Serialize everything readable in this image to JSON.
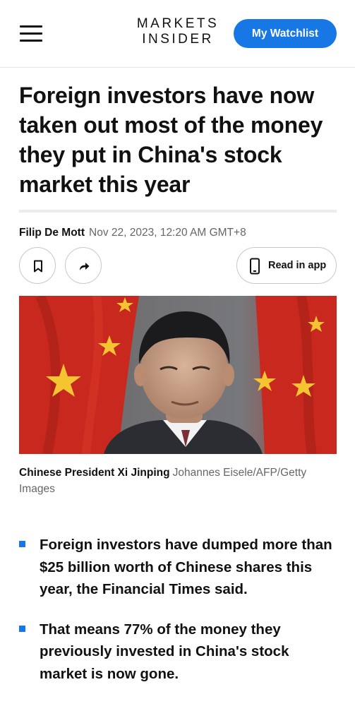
{
  "header": {
    "logo_line1": "MARKETS",
    "logo_line2": "INSIDER",
    "watchlist_label": "My Watchlist",
    "menu_icon": "hamburger-menu-icon",
    "accent_color": "#1677e5"
  },
  "article": {
    "headline": "Foreign investors have now taken out most of the money they put in China's stock market this year",
    "author": "Filip De Mott",
    "date": "Nov 22, 2023, 12:20 AM GMT+8",
    "actions": {
      "bookmark_icon": "bookmark-icon",
      "share_icon": "share-icon",
      "read_in_app_label": "Read in app",
      "phone_icon": "phone-icon"
    },
    "image": {
      "caption": "Chinese President Xi Jinping",
      "credit": "Johannes Eisele/AFP/Getty Images"
    },
    "bullets": [
      {
        "text": "Foreign investors have dumped more than $25 billion worth of Chinese shares this year, the Financial Times said."
      },
      {
        "text": "That means 77% of the money they previously invested in China's stock market is now gone."
      }
    ]
  }
}
